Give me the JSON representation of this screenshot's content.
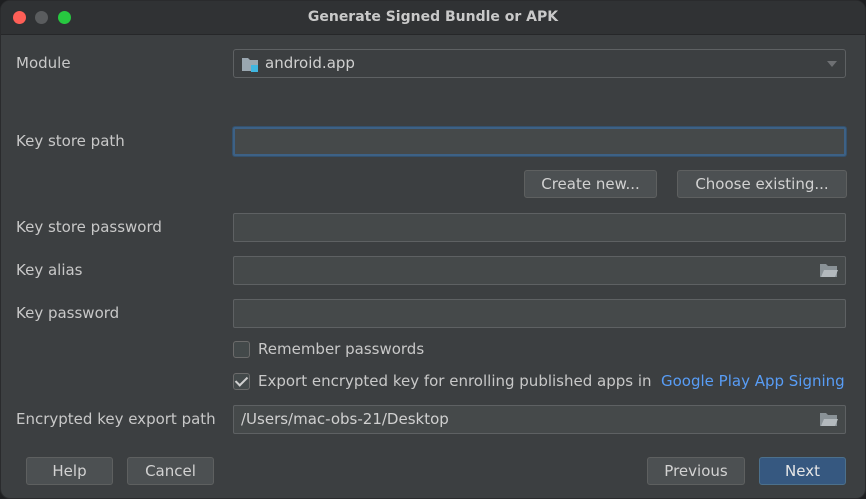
{
  "window": {
    "title": "Generate Signed Bundle or APK"
  },
  "module": {
    "label": "Module",
    "value": "android.app",
    "icon": "folder-module-icon"
  },
  "keystore_path": {
    "label": "Key store path",
    "value": ""
  },
  "keystore_buttons": {
    "create_new": "Create new...",
    "choose_existing": "Choose existing..."
  },
  "keystore_password": {
    "label": "Key store password",
    "value": ""
  },
  "key_alias": {
    "label": "Key alias",
    "value": "",
    "icon": "folder-browse-icon"
  },
  "key_password": {
    "label": "Key password",
    "value": ""
  },
  "remember_passwords": {
    "label": "Remember passwords",
    "checked": false
  },
  "export_key": {
    "label": "Export encrypted key for enrolling published apps in",
    "link": "Google Play App Signing",
    "checked": true
  },
  "export_path": {
    "label": "Encrypted key export path",
    "value": "/Users/mac-obs-21/Desktop",
    "icon": "folder-browse-icon"
  },
  "footer": {
    "help": "Help",
    "cancel": "Cancel",
    "previous": "Previous",
    "next": "Next"
  },
  "colors": {
    "accent": "#365880",
    "link": "#589df6",
    "focus": "#3d6185"
  }
}
